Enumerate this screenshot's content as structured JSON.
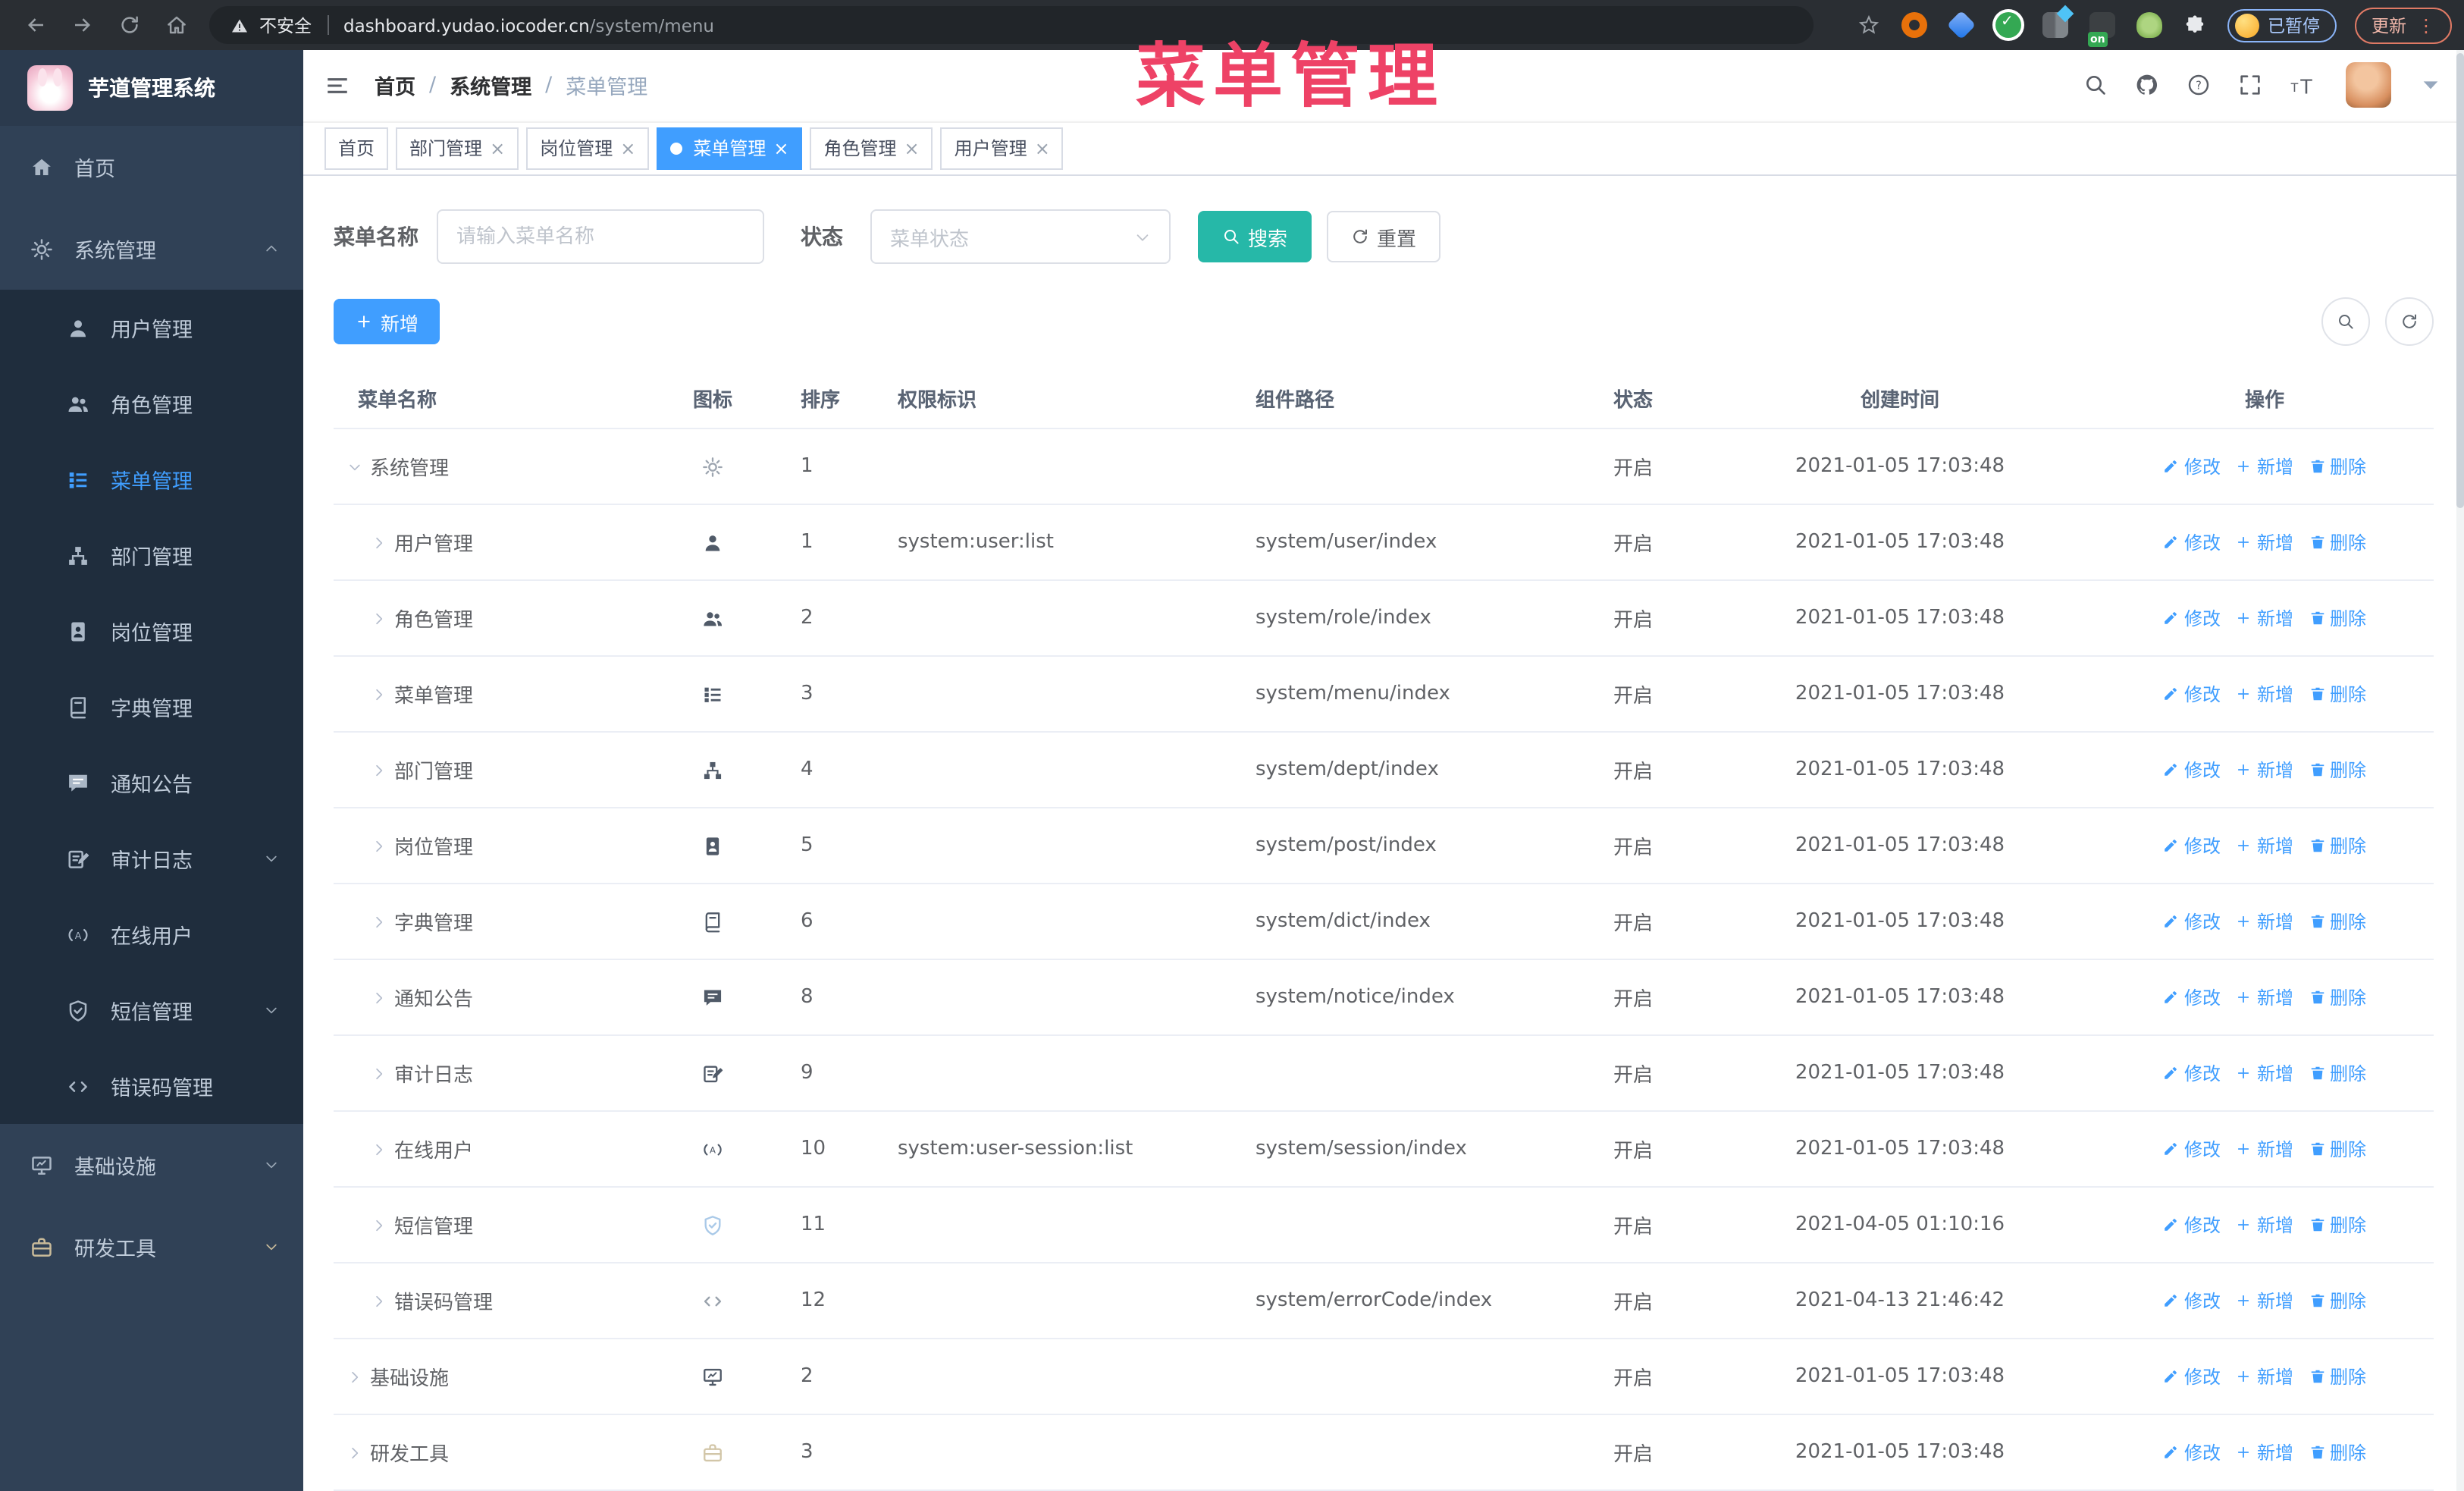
{
  "overlay_title": "菜单管理",
  "browser": {
    "security_label": "不安全",
    "url": "dashboard.yudao.iocoder.cn",
    "url_path": "/system/menu",
    "paused_badge": "已暂停",
    "update_button": "更新",
    "toolbar_icons": [
      "back-icon",
      "forward-icon",
      "reload-icon",
      "browser-home-icon",
      "star-icon",
      "extensions-puzzle-icon"
    ]
  },
  "sidebar": {
    "app_title": "芋道管理系统",
    "items": [
      {
        "key": "home",
        "label": "首页",
        "icon": "home-icon",
        "type": "top"
      },
      {
        "key": "system",
        "label": "系统管理",
        "icon": "gear-icon",
        "type": "top",
        "arrow": "up"
      },
      {
        "key": "user",
        "label": "用户管理",
        "icon": "user-icon",
        "type": "sub"
      },
      {
        "key": "role",
        "label": "角色管理",
        "icon": "users-icon",
        "type": "sub"
      },
      {
        "key": "menu",
        "label": "菜单管理",
        "icon": "menu-list-icon",
        "type": "sub",
        "active": true
      },
      {
        "key": "dept",
        "label": "部门管理",
        "icon": "org-tree-icon",
        "type": "sub"
      },
      {
        "key": "post",
        "label": "岗位管理",
        "icon": "badge-icon",
        "type": "sub"
      },
      {
        "key": "dict",
        "label": "字典管理",
        "icon": "dict-icon",
        "type": "sub"
      },
      {
        "key": "notice",
        "label": "通知公告",
        "icon": "notice-icon",
        "type": "sub"
      },
      {
        "key": "audit-log",
        "label": "审计日志",
        "icon": "audit-icon",
        "type": "sub",
        "arrow": "down"
      },
      {
        "key": "online-user",
        "label": "在线用户",
        "icon": "online-icon",
        "type": "sub"
      },
      {
        "key": "sms",
        "label": "短信管理",
        "icon": "sms-icon",
        "type": "sub",
        "arrow": "down"
      },
      {
        "key": "error-code",
        "label": "错误码管理",
        "icon": "code-icon",
        "type": "sub"
      },
      {
        "key": "infra",
        "label": "基础设施",
        "icon": "infra-icon",
        "type": "top",
        "arrow": "down"
      },
      {
        "key": "dev-tools",
        "label": "研发工具",
        "icon": "tools-icon",
        "type": "top",
        "arrow": "down",
        "tint": "tools"
      }
    ]
  },
  "header": {
    "breadcrumb": [
      "首页",
      "系统管理",
      "菜单管理"
    ]
  },
  "tabs": [
    {
      "key": "home",
      "label": "首页",
      "closable": false,
      "active": false
    },
    {
      "key": "dept",
      "label": "部门管理",
      "closable": true,
      "active": false
    },
    {
      "key": "post",
      "label": "岗位管理",
      "closable": true,
      "active": false
    },
    {
      "key": "menu",
      "label": "菜单管理",
      "closable": true,
      "active": true
    },
    {
      "key": "role",
      "label": "角色管理",
      "closable": true,
      "active": false
    },
    {
      "key": "user",
      "label": "用户管理",
      "closable": true,
      "active": false
    }
  ],
  "filters": {
    "name_label": "菜单名称",
    "name_placeholder": "请输入菜单名称",
    "status_label": "状态",
    "status_placeholder": "菜单状态",
    "search_button": "搜索",
    "reset_button": "重置"
  },
  "toolbar": {
    "add_button": "新增"
  },
  "table": {
    "columns": [
      "菜单名称",
      "图标",
      "排序",
      "权限标识",
      "组件路径",
      "状态",
      "创建时间",
      "操作"
    ],
    "actions": {
      "edit": "修改",
      "add": "新增",
      "delete": "删除"
    },
    "rows": [
      {
        "name": "系统管理",
        "level": 0,
        "expanded": true,
        "icon": "gear-icon",
        "icon_color": "#9da5b0",
        "sort": "1",
        "perm": "",
        "path": "",
        "status": "开启",
        "created": "2021-01-05 17:03:48"
      },
      {
        "name": "用户管理",
        "level": 1,
        "icon": "user-icon",
        "sort": "1",
        "perm": "system:user:list",
        "path": "system/user/index",
        "status": "开启",
        "created": "2021-01-05 17:03:48"
      },
      {
        "name": "角色管理",
        "level": 1,
        "icon": "users-icon",
        "sort": "2",
        "perm": "",
        "path": "system/role/index",
        "status": "开启",
        "created": "2021-01-05 17:03:48"
      },
      {
        "name": "菜单管理",
        "level": 1,
        "icon": "menu-list-icon",
        "sort": "3",
        "perm": "",
        "path": "system/menu/index",
        "status": "开启",
        "created": "2021-01-05 17:03:48"
      },
      {
        "name": "部门管理",
        "level": 1,
        "icon": "org-tree-icon",
        "sort": "4",
        "perm": "",
        "path": "system/dept/index",
        "status": "开启",
        "created": "2021-01-05 17:03:48"
      },
      {
        "name": "岗位管理",
        "level": 1,
        "icon": "badge-icon",
        "sort": "5",
        "perm": "",
        "path": "system/post/index",
        "status": "开启",
        "created": "2021-01-05 17:03:48"
      },
      {
        "name": "字典管理",
        "level": 1,
        "icon": "dict-icon",
        "sort": "6",
        "perm": "",
        "path": "system/dict/index",
        "status": "开启",
        "created": "2021-01-05 17:03:48"
      },
      {
        "name": "通知公告",
        "level": 1,
        "icon": "notice-icon",
        "sort": "8",
        "perm": "",
        "path": "system/notice/index",
        "status": "开启",
        "created": "2021-01-05 17:03:48"
      },
      {
        "name": "审计日志",
        "level": 1,
        "icon": "audit-icon",
        "sort": "9",
        "perm": "",
        "path": "",
        "status": "开启",
        "created": "2021-01-05 17:03:48"
      },
      {
        "name": "在线用户",
        "level": 1,
        "icon": "online-icon",
        "sort": "10",
        "perm": "system:user-session:list",
        "path": "system/session/index",
        "status": "开启",
        "created": "2021-01-05 17:03:48"
      },
      {
        "name": "短信管理",
        "level": 1,
        "icon": "sms-icon",
        "icon_color": "#a9c9e8",
        "sort": "11",
        "perm": "",
        "path": "",
        "status": "开启",
        "created": "2021-04-05 01:10:16"
      },
      {
        "name": "错误码管理",
        "level": 1,
        "icon": "code-icon",
        "icon_color": "#9aa3ad",
        "sort": "12",
        "perm": "",
        "path": "system/errorCode/index",
        "status": "开启",
        "created": "2021-04-13 21:46:42"
      },
      {
        "name": "基础设施",
        "level": 0,
        "icon": "infra-icon",
        "sort": "2",
        "perm": "",
        "path": "",
        "status": "开启",
        "created": "2021-01-05 17:03:48"
      },
      {
        "name": "研发工具",
        "level": 0,
        "icon": "tools-icon",
        "icon_color": "#d2c6a8",
        "sort": "3",
        "perm": "",
        "path": "",
        "status": "开启",
        "created": "2021-01-05 17:03:48"
      }
    ]
  },
  "colors": {
    "primary": "#409EFF",
    "search_teal": "#26B8A8",
    "overlay_pink": "#EE4266",
    "sidebar_bg": "#304156",
    "submenu_bg": "#1F2D3D"
  }
}
